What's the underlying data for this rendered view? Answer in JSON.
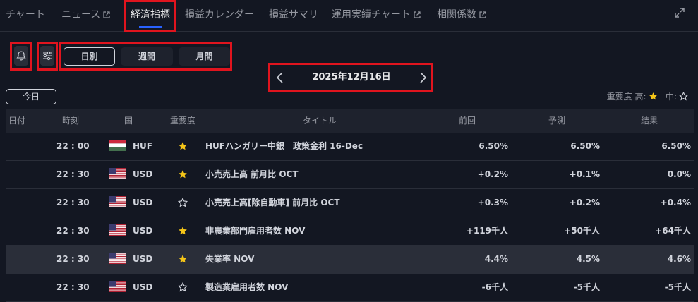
{
  "tabs": [
    {
      "label": "チャート",
      "external": false
    },
    {
      "label": "ニュース",
      "external": true
    },
    {
      "label": "経済指標",
      "external": false,
      "active": true
    },
    {
      "label": "損益カレンダー",
      "external": false
    },
    {
      "label": "損益サマリ",
      "external": false
    },
    {
      "label": "運用実績チャート",
      "external": true
    },
    {
      "label": "相関係数",
      "external": true
    }
  ],
  "toolbar": {
    "alert_icon": "bell-icon",
    "filter_icon": "sliders-icon",
    "periods": [
      "日別",
      "週間",
      "月間"
    ],
    "active_period": "日別",
    "date": "2025年12月16日",
    "today_label": "今日"
  },
  "legend": {
    "label": "重要度 高:",
    "mid_label": "中:"
  },
  "table": {
    "headers": [
      "日付",
      "時刻",
      "国",
      "重要度",
      "タイトル",
      "前回",
      "予測",
      "結果"
    ],
    "rows": [
      {
        "time": "22 : 00",
        "flag": "hu",
        "currency": "HUF",
        "importance": "high",
        "title": "HUFハンガリー中銀　政策金利 16-Dec",
        "previous": "6.50%",
        "forecast": "6.50%",
        "result": "6.50%"
      },
      {
        "time": "22 : 30",
        "flag": "us",
        "currency": "USD",
        "importance": "high",
        "title": "小売売上高 前月比 OCT",
        "previous": "+0.2%",
        "forecast": "+0.1%",
        "result": "0.0%"
      },
      {
        "time": "22 : 30",
        "flag": "us",
        "currency": "USD",
        "importance": "medium",
        "title": "小売売上高[除自動車] 前月比 OCT",
        "previous": "+0.3%",
        "forecast": "+0.2%",
        "result": "+0.4%"
      },
      {
        "time": "22 : 30",
        "flag": "us",
        "currency": "USD",
        "importance": "high",
        "title": "非農業部門雇用者数 NOV",
        "previous": "+119千人",
        "forecast": "+50千人",
        "result": "+64千人"
      },
      {
        "time": "22 : 30",
        "flag": "us",
        "currency": "USD",
        "importance": "high",
        "title": "失業率 NOV",
        "previous": "4.4%",
        "forecast": "4.5%",
        "result": "4.6%"
      },
      {
        "time": "22 : 30",
        "flag": "us",
        "currency": "USD",
        "importance": "medium",
        "title": "製造業雇用者数 NOV",
        "previous": "-6千人",
        "forecast": "-5千人",
        "result": "-5千人"
      }
    ]
  },
  "colors": {
    "accent": "#2962ff",
    "star": "#f5c518",
    "highlight_box": "#e0141e"
  }
}
